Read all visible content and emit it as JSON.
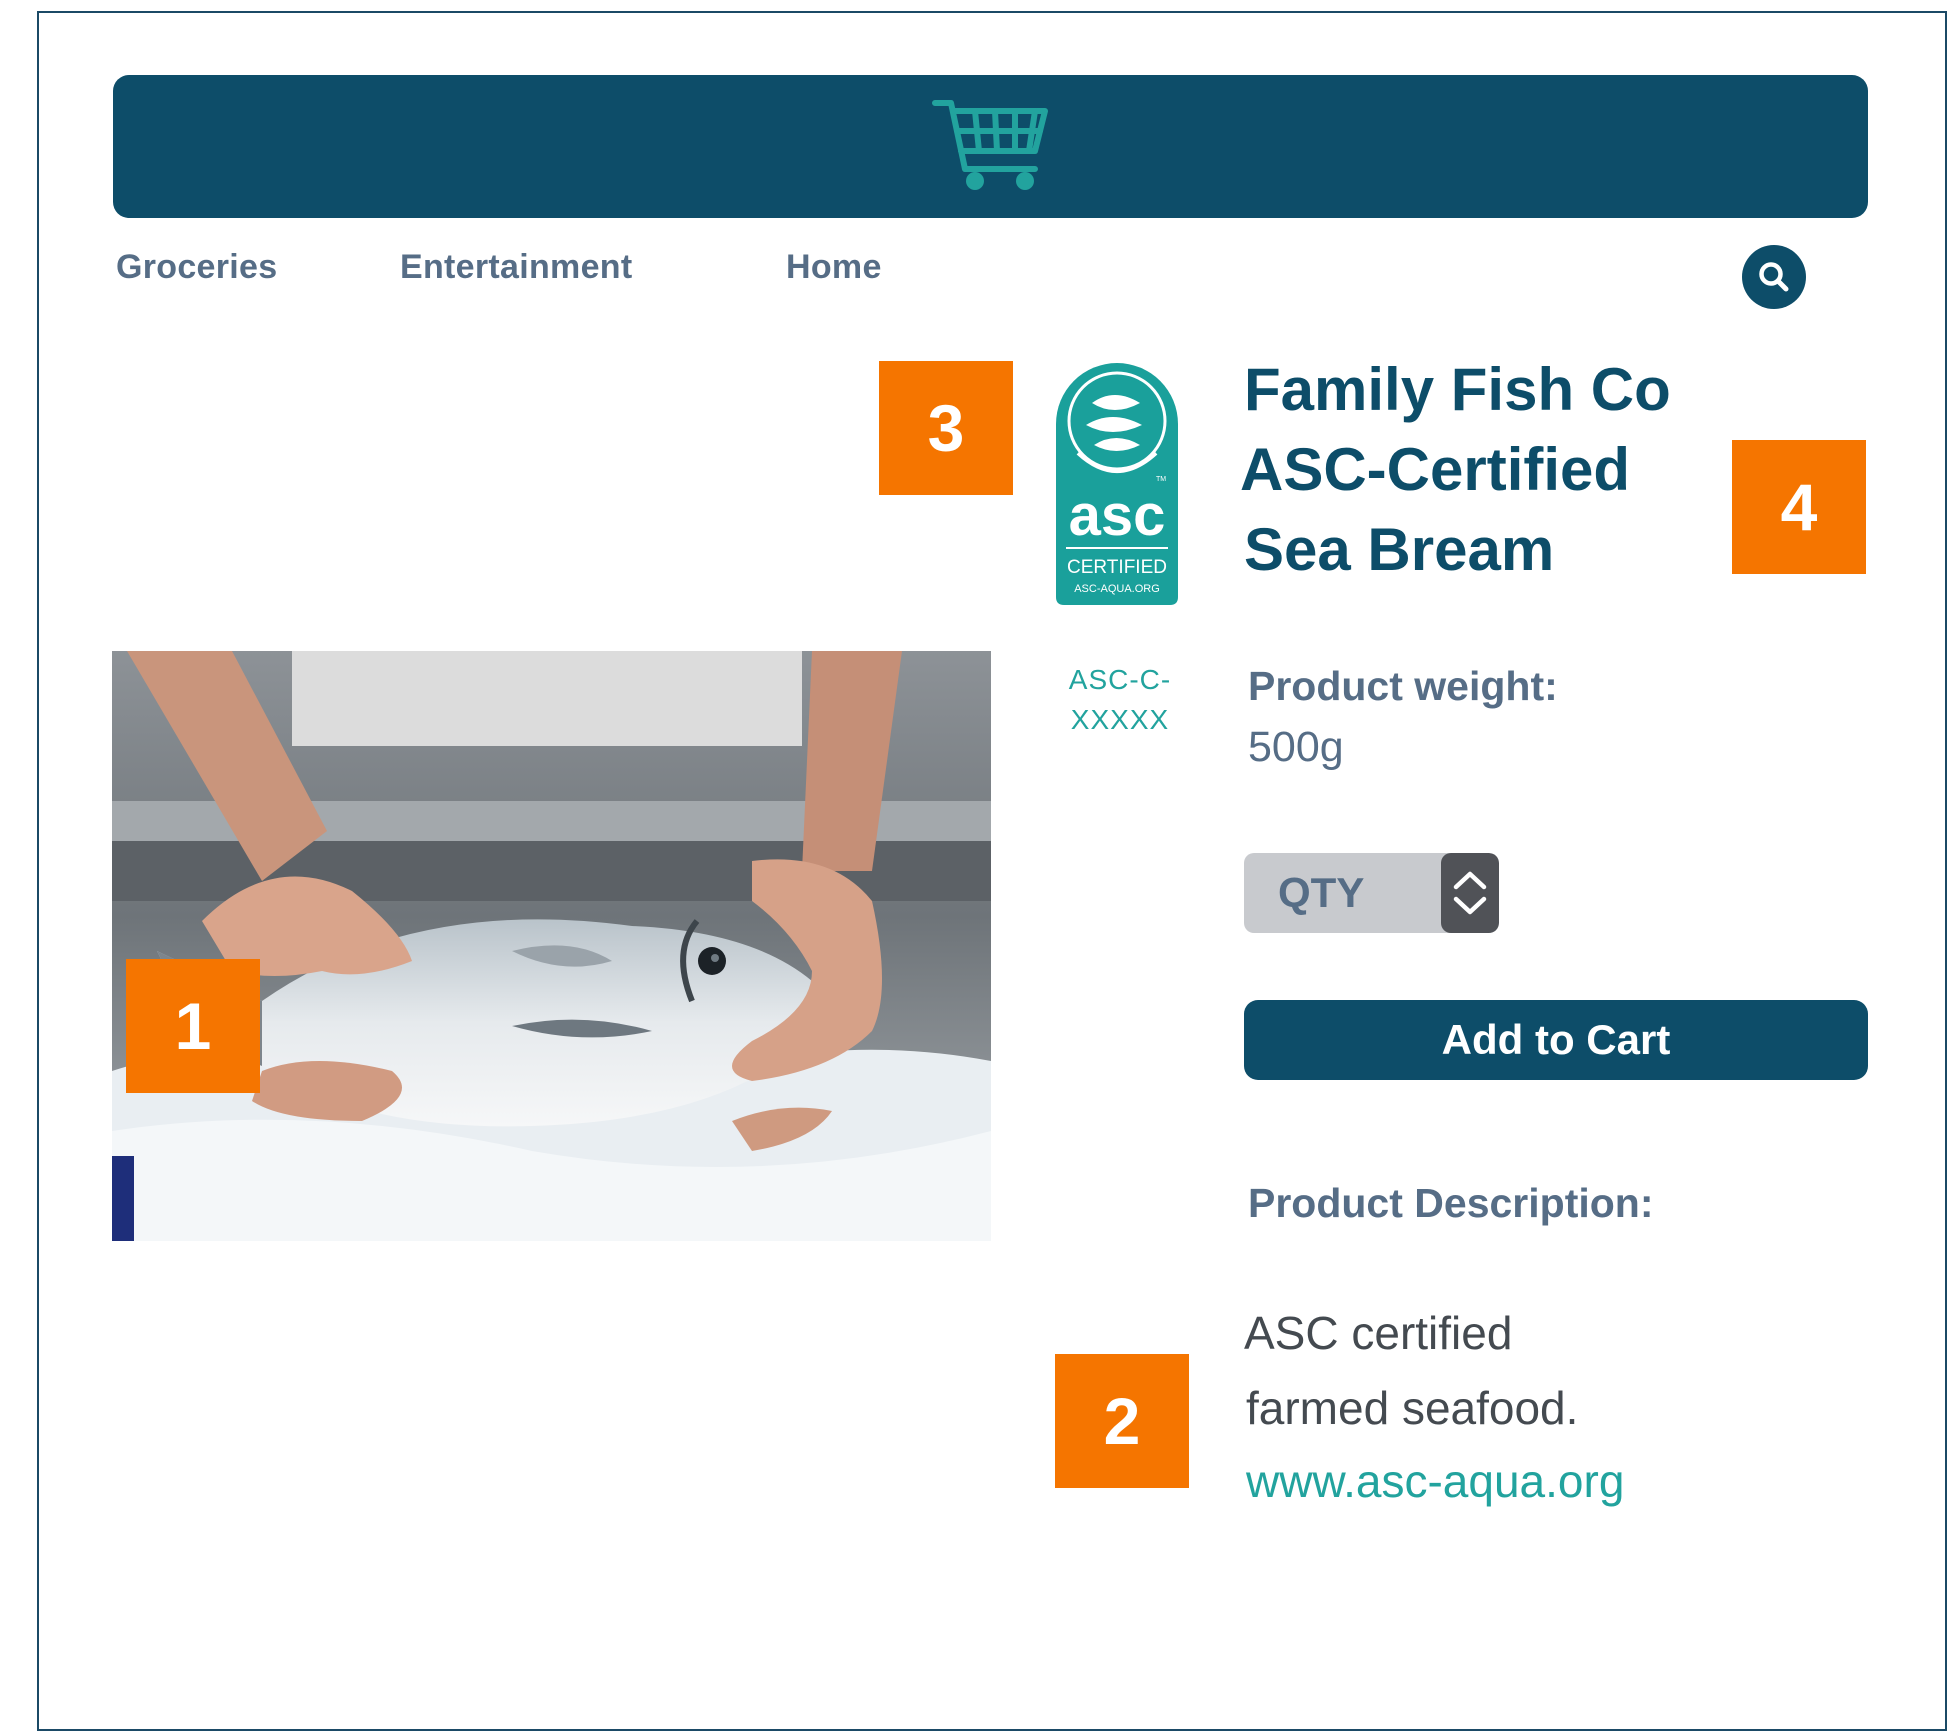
{
  "header": {
    "cart_icon": "cart-icon",
    "brand_color": "#0d4d69"
  },
  "nav": {
    "items": [
      {
        "label": "Groceries"
      },
      {
        "label": "Entertainment"
      },
      {
        "label": "Home"
      }
    ],
    "search_icon": "search-icon"
  },
  "markers": [
    "1",
    "2",
    "3",
    "4"
  ],
  "certification": {
    "logo_text": "asc",
    "logo_certified": "CERTIFIED",
    "logo_url": "ASC-AQUA.ORG",
    "logo_tm": "TM",
    "code_line1": "ASC-C-",
    "code_line2": "XXXXX"
  },
  "product": {
    "title_line1": "Family Fish Co",
    "title_line2": "ASC-Certified",
    "title_line3": "Sea Bream",
    "weight_label": "Product weight:",
    "weight_value": "500g",
    "qty_label": "QTY",
    "add_to_cart_label": "Add to Cart",
    "description_label": "Product Description:",
    "description_line1": "ASC certified",
    "description_line2": "farmed seafood.",
    "description_link": "www.asc-aqua.org"
  },
  "colors": {
    "brand": "#0d4d69",
    "accent": "#f57500",
    "teal": "#22a39e",
    "nav_text": "#566d86"
  }
}
